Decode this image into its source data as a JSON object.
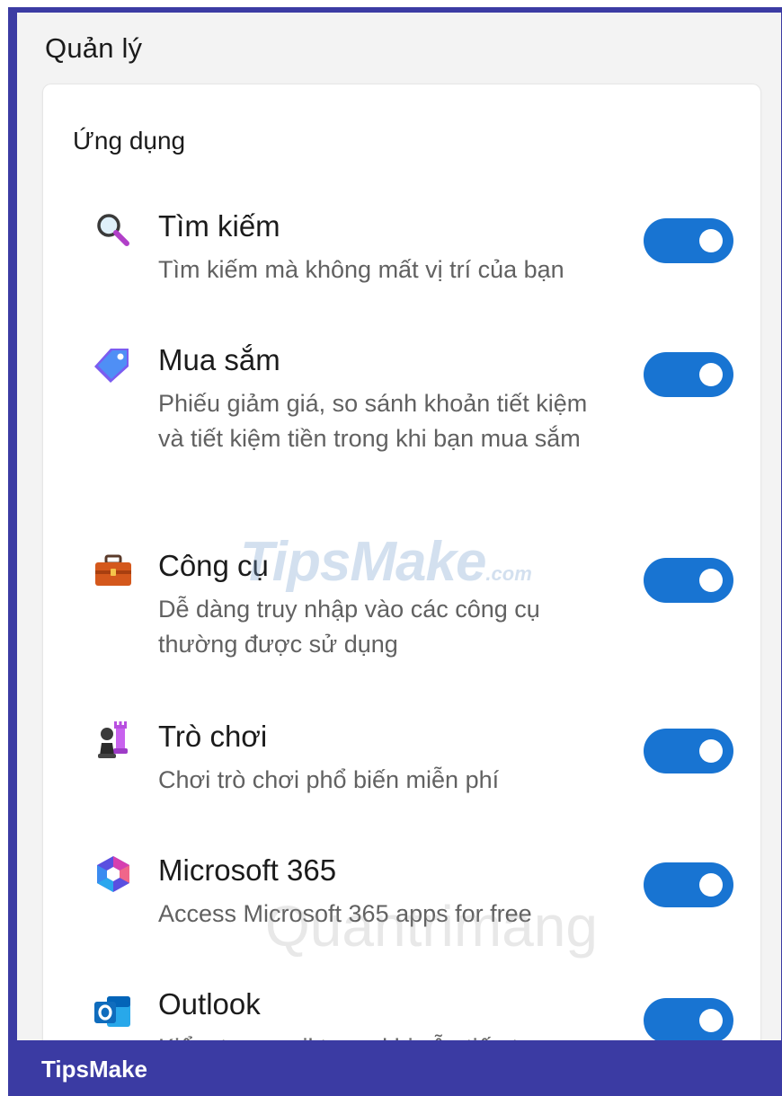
{
  "settings": {
    "section_title": "Quản lý",
    "card_title": "Ứng dụng",
    "apps": [
      {
        "title": "Tìm kiếm",
        "description": "Tìm kiếm mà không mất vị trí của bạn",
        "icon": "magnifier-icon",
        "enabled": true
      },
      {
        "title": "Mua sắm",
        "description": "Phiếu giảm giá, so sánh khoản tiết kiệm và tiết kiệm tiền trong khi bạn mua sắm",
        "icon": "price-tag-icon",
        "enabled": true
      },
      {
        "title": "Công cụ",
        "description": "Dễ dàng truy nhập vào các công cụ thường được sử dụng",
        "icon": "toolbox-icon",
        "enabled": true
      },
      {
        "title": "Trò chơi",
        "description": "Chơi trò chơi phổ biến miễn phí",
        "icon": "chess-pieces-icon",
        "enabled": true
      },
      {
        "title": "Microsoft 365",
        "description": "Access Microsoft 365 apps for free",
        "icon": "microsoft-365-icon",
        "enabled": true
      },
      {
        "title": "Outlook",
        "description": "Kiểm tra email trong khi vẫn tiếp tục",
        "icon": "outlook-icon",
        "enabled": true
      }
    ]
  },
  "watermarks": {
    "tipsmake_text": "TipsMake",
    "tipsmake_suffix": ".com",
    "quantrimang_text": "Quantrimang"
  },
  "footer": {
    "label": "TipsMake"
  },
  "colors": {
    "toggle_on": "#1874d2",
    "frame": "#3b3ba3",
    "panel_bg": "#f3f3f3"
  }
}
